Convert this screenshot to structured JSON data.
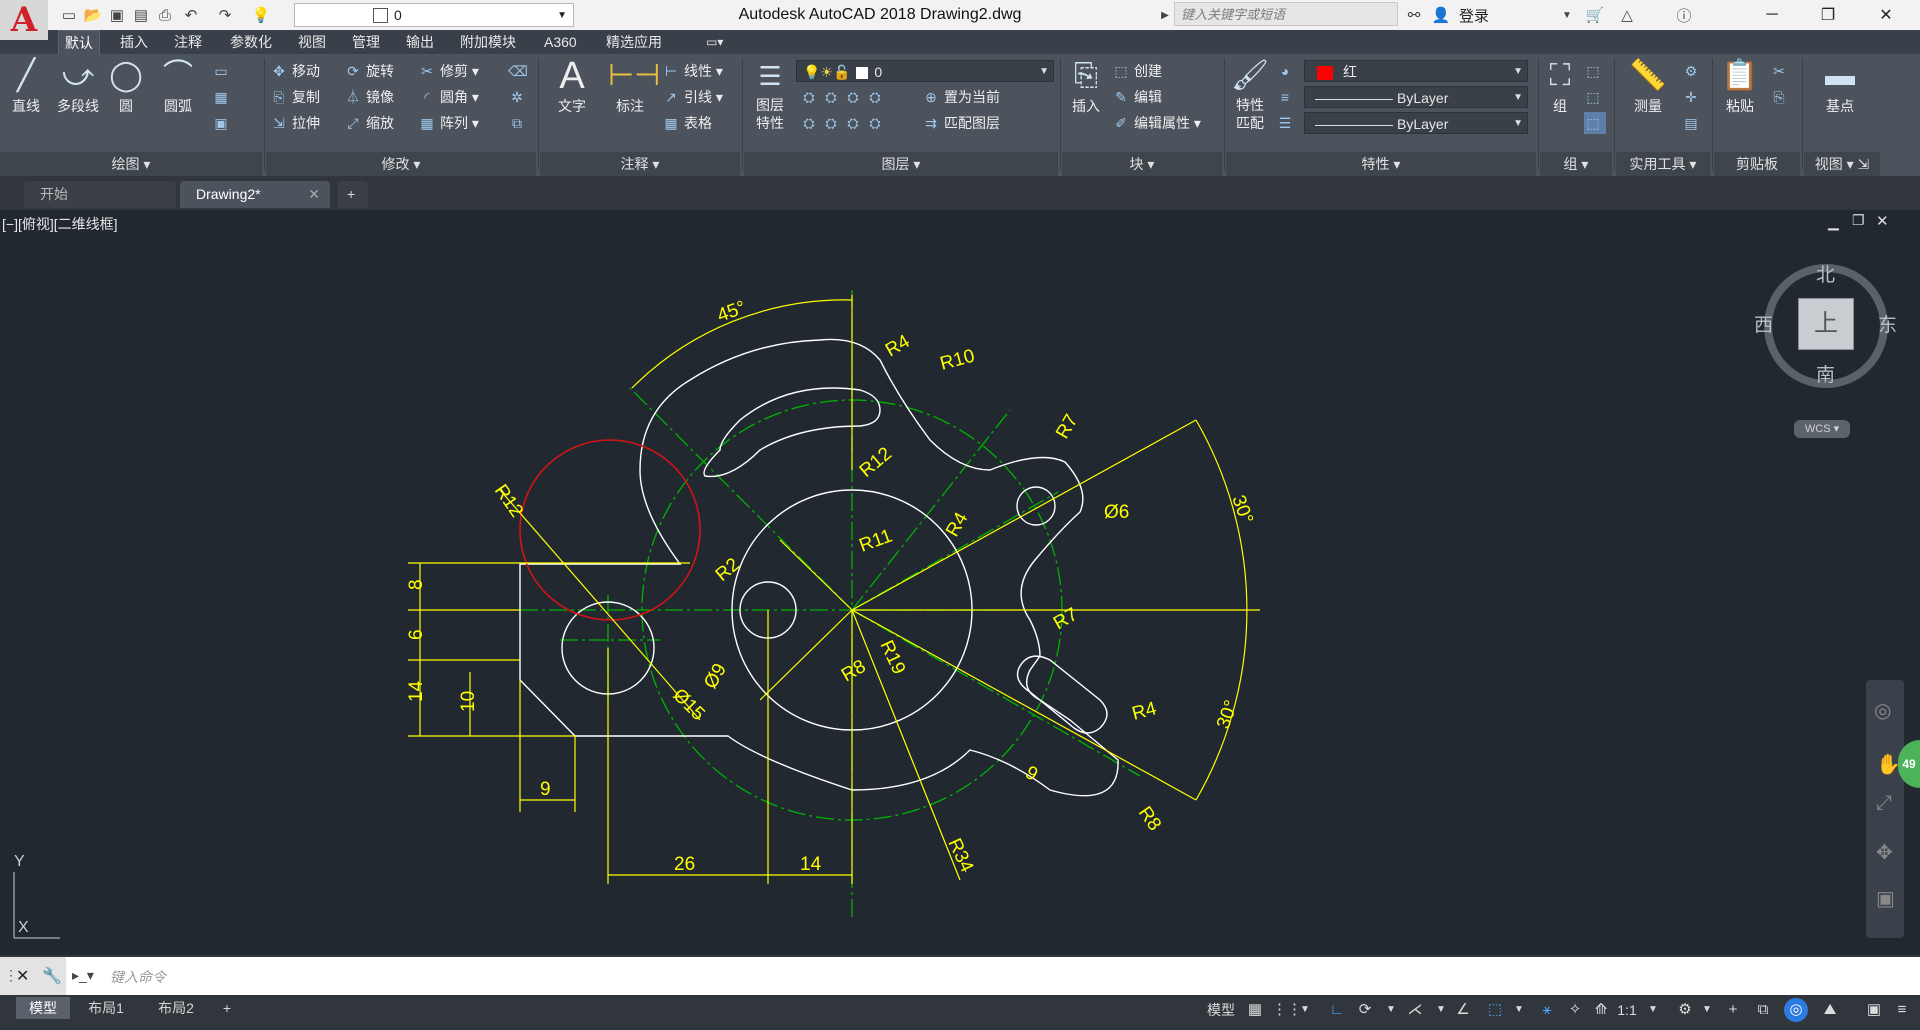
{
  "app": {
    "logo": "A",
    "title": "Autodesk AutoCAD 2018    Drawing2.dwg",
    "search_placeholder": "键入关键字或短语",
    "login": "登录",
    "layer_combo_value": "0"
  },
  "ribbon_tabs": [
    "默认",
    "插入",
    "注释",
    "参数化",
    "视图",
    "管理",
    "输出",
    "附加模块",
    "A360",
    "精选应用"
  ],
  "draw_panel": {
    "title": "绘图",
    "line": "直线",
    "polyline": "多段线",
    "circle": "圆",
    "arc": "圆弧"
  },
  "modify_panel": {
    "title": "修改",
    "move": "移动",
    "rotate": "旋转",
    "trim": "修剪",
    "copy": "复制",
    "mirror": "镜像",
    "fillet": "圆角",
    "stretch": "拉伸",
    "scale": "缩放",
    "array": "阵列"
  },
  "annotation_panel": {
    "title": "注释",
    "text": "文字",
    "dimension": "标注",
    "linear": "线性",
    "leader": "引线",
    "table": "表格"
  },
  "layers_panel": {
    "title": "图层",
    "layer_props": "图层\n特性",
    "layer_value": "0",
    "make_current": "置为当前",
    "match_layer": "匹配图层"
  },
  "block_panel": {
    "title": "块",
    "insert": "插入",
    "create": "创建",
    "edit": "编辑",
    "edit_attr": "编辑属性"
  },
  "properties_panel": {
    "title": "特性",
    "match": "特性\n匹配",
    "color": "红",
    "color_hex": "#ff0000",
    "linetype": "ByLayer",
    "lineweight": "ByLayer"
  },
  "groups_panel": {
    "title": "组",
    "group": "组"
  },
  "utilities_panel": {
    "title": "实用工具",
    "measure": "测量"
  },
  "clipboard_panel": {
    "title": "剪贴板",
    "paste": "粘贴"
  },
  "view_panel": {
    "title": "视图",
    "base": "基点"
  },
  "doc_tabs": [
    "开始",
    "Drawing2*"
  ],
  "viewport": {
    "label": "[−][俯视][二维线框]",
    "viewcube": {
      "north": "北",
      "south": "南",
      "east": "东",
      "west": "西",
      "top": "上",
      "wcs": "WCS"
    },
    "nav_badge": "49",
    "ucs_y": "Y",
    "ucs_x": "X"
  },
  "dimensions": {
    "angle_top": "45°",
    "r4_top": "R4",
    "r10": "R10",
    "r12_mid": "R12",
    "r7_top": "R7",
    "d6": "Ø6",
    "angle_right_top": "30°",
    "angle_right_bottom": "30°",
    "r12_left": "R12",
    "r2": "R2",
    "r11": "R11",
    "r4_mid": "R4",
    "r7_mid": "R7",
    "d9": "Ø9",
    "r8_mid": "R8",
    "r19": "R19",
    "d15": "Ø15",
    "v8": "8",
    "v6": "6",
    "v14": "14",
    "v10": "10",
    "h9_left": "9",
    "h26": "26",
    "h14": "14",
    "r34": "R34",
    "r4_bottom": "R4",
    "h9_bottom": "9",
    "r8_bottom": "R8"
  },
  "command_line": {
    "placeholder": "键入命令"
  },
  "layout_tabs": [
    "模型",
    "布局1",
    "布局2"
  ],
  "status": {
    "model": "模型",
    "scale": "1:1"
  },
  "colors": {
    "dim": "#ffff00",
    "center": "#00b400",
    "outline": "#ffffff",
    "highlight": "#d21414",
    "background": "#212830"
  }
}
